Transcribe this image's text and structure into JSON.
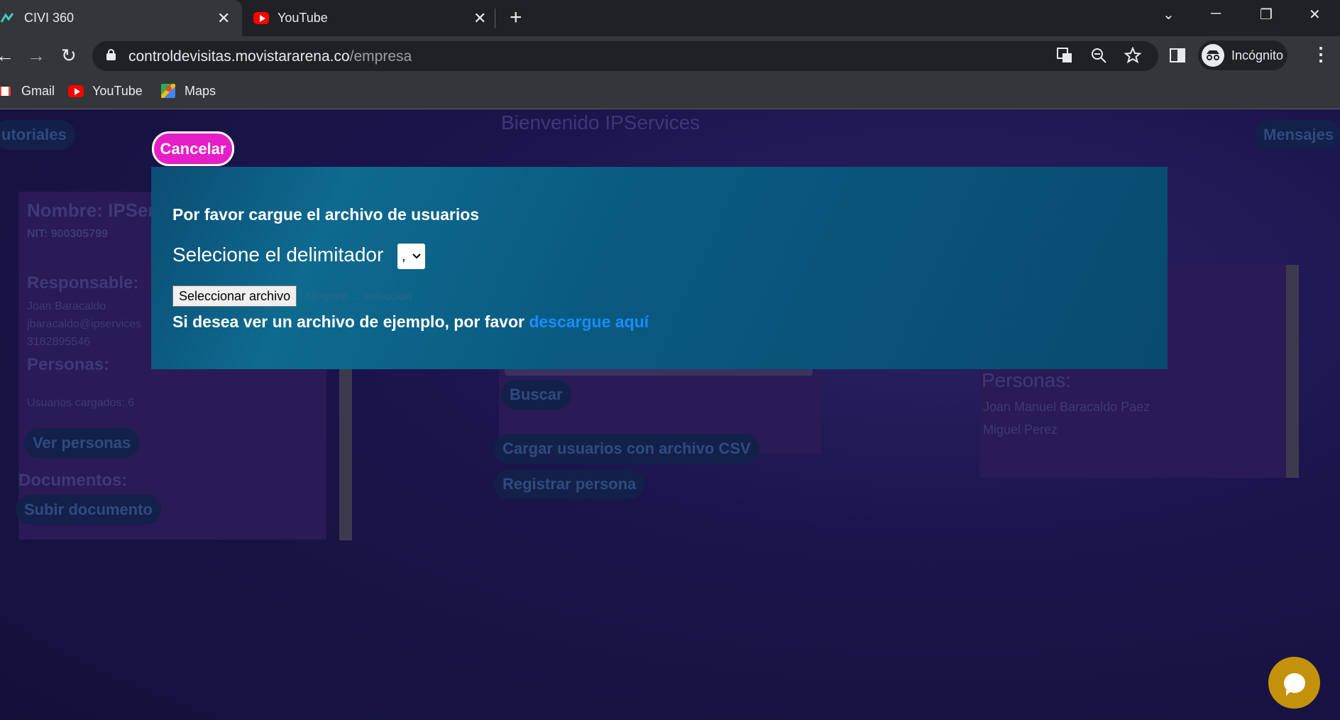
{
  "browser": {
    "tabs": [
      {
        "title": "CIVI 360",
        "close": "✕"
      },
      {
        "title": "YouTube",
        "close": "✕"
      }
    ],
    "new_tab": "+",
    "window_controls": {
      "dropdown": "⌄",
      "minimize": "─",
      "restore": "❐",
      "close": "✕"
    },
    "nav": {
      "back": "←",
      "forward": "→",
      "reload": "↻"
    },
    "url_host": "controldevisitas.movistararena.co",
    "url_path": "/empresa",
    "incognito_label": "Incógnito",
    "menu": "⋮",
    "bookmarks": [
      {
        "label": "Gmail"
      },
      {
        "label": "YouTube"
      },
      {
        "label": "Maps"
      }
    ]
  },
  "page": {
    "welcome": "Bienvenido IPServices",
    "tutoriales": "utoriales",
    "mensajes": "Mensajes",
    "left_card": {
      "nombre": "Nombre: IPSer",
      "nit": "NIT: 900305799",
      "responsable_heading": "Responsable:",
      "responsable_name": "Joan Baracaldo",
      "responsable_email": "jbaracaldo@ipservices",
      "responsable_phone": "3182895546",
      "personas_heading": "Personas:",
      "usuarios_cargados": "Usuarios cargados: 6",
      "ver_personas": "Ver personas",
      "documentos_heading": "Documentos:",
      "subir_documento": "Subir documento"
    },
    "mid": {
      "buscar": "Buscar",
      "cargar_csv": "Cargar usuarios con archivo CSV",
      "registrar": "Registrar persona"
    },
    "right_card": {
      "personas_heading": "Personas:",
      "people": [
        "Joan Manuel Baracaldo Paez",
        "Miguel Perez"
      ]
    }
  },
  "modal": {
    "cancel": "Cancelar",
    "title": "Por favor cargue el archivo de usuarios",
    "delimiter_label": "Selecione el delimitador",
    "delimiter_value": ",",
    "file_button": "Seleccionar archivo",
    "file_status": "Ninguno   ... seleccion",
    "example_prefix": "Si desea ver un archivo de ejemplo, por favor ",
    "example_link": "descargue aquí"
  },
  "colors": {
    "accent_cancel": "#e61ec8",
    "link": "#1a8cff",
    "chat": "#c4920a"
  }
}
